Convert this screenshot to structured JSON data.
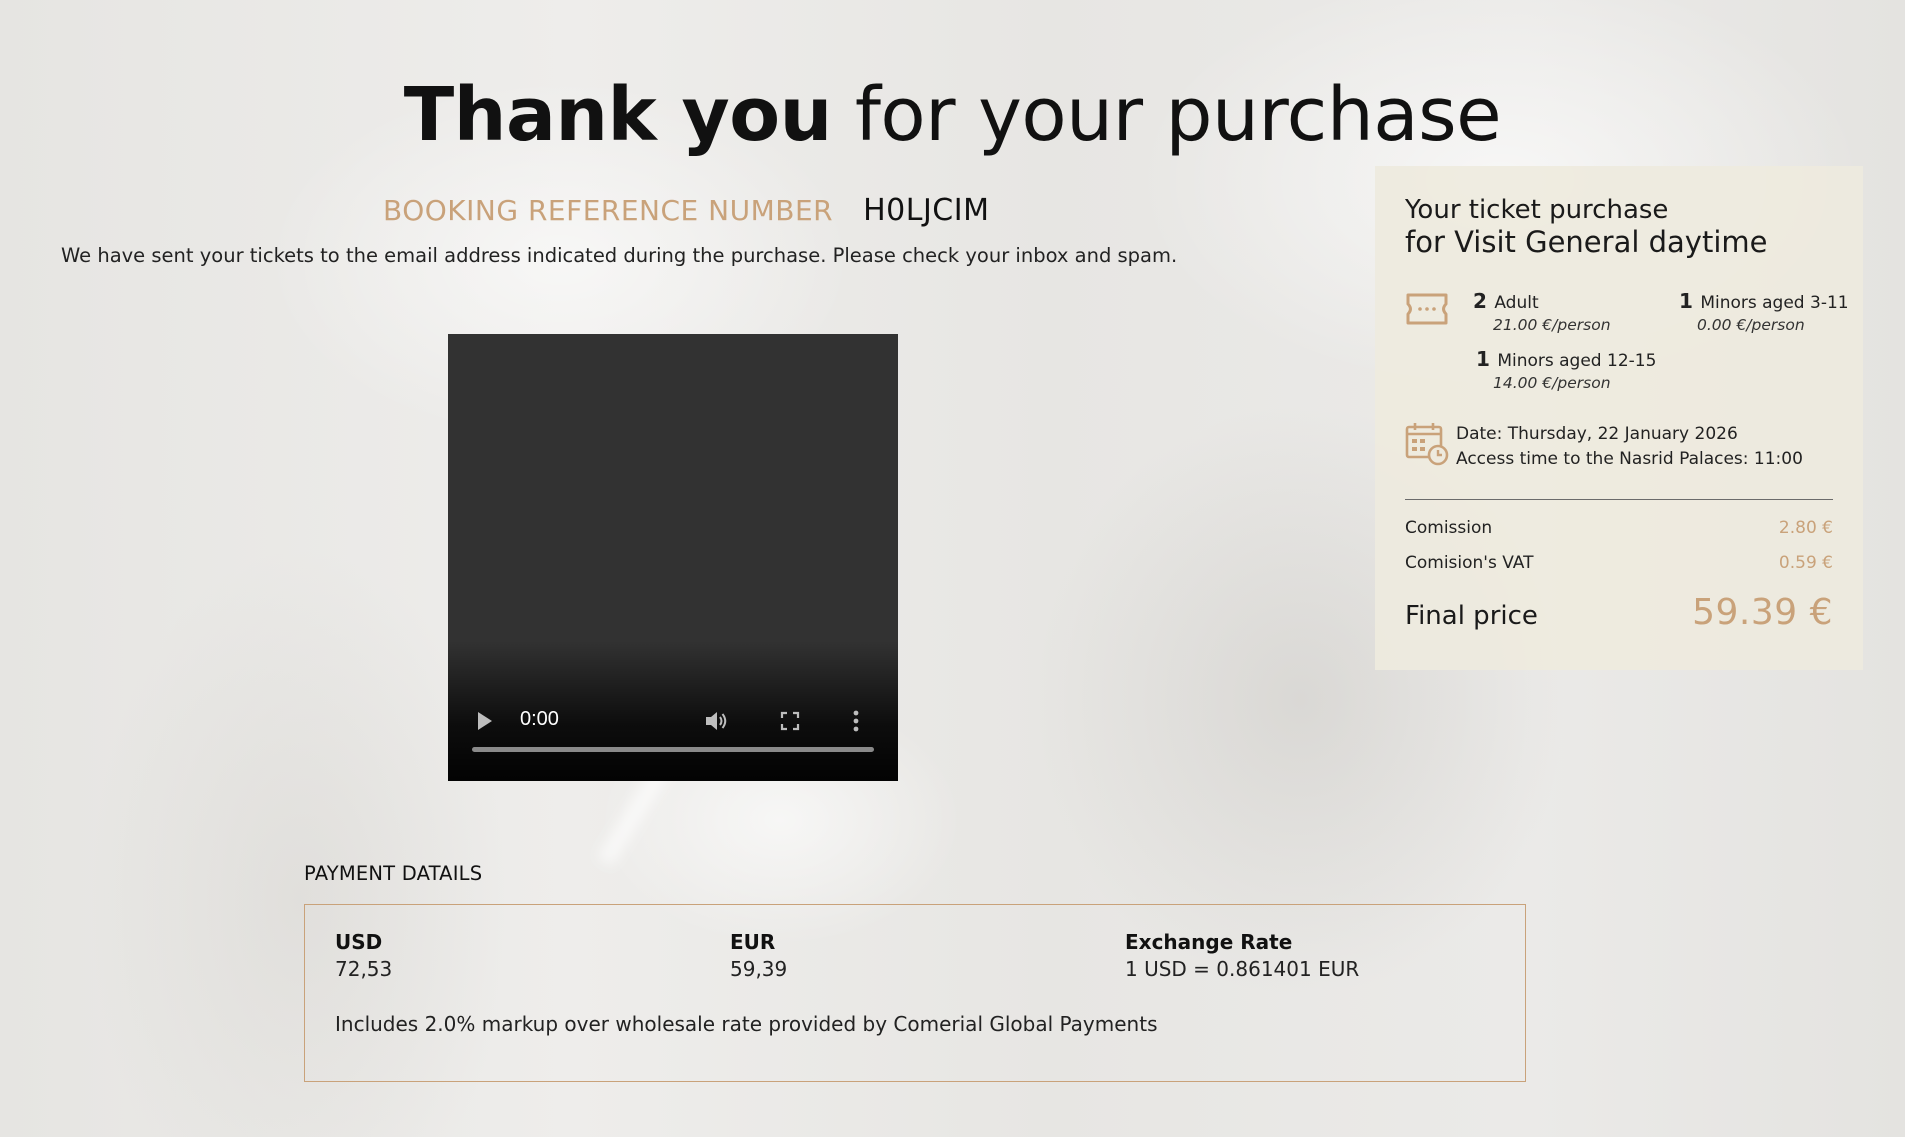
{
  "header": {
    "title_strong": "Thank you",
    "title_rest": "for your purchase"
  },
  "booking": {
    "label": "BOOKING REFERENCE NUMBER",
    "code": "H0LJCIM",
    "sent_message": "We have sent your tickets to the email address indicated during the purchase. Please check your inbox and spam."
  },
  "video": {
    "current_time": "0:00",
    "progress": 0
  },
  "payment": {
    "title": "PAYMENT DATAILS",
    "columns": [
      {
        "head": "USD",
        "value": "72,53"
      },
      {
        "head": "EUR",
        "value": "59,39"
      },
      {
        "head": "Exchange Rate",
        "value": "1 USD = 0.861401 EUR"
      }
    ],
    "note": "Includes 2.0% markup over wholesale rate provided by Comerial Global Payments"
  },
  "summary": {
    "title_line1": "Your ticket purchase",
    "title_line2": "for Visit General daytime",
    "tickets": [
      {
        "qty": "2",
        "label": "Adult",
        "price": "21.00 €/person"
      },
      {
        "qty": "1",
        "label": "Minors aged 3-11",
        "price": "0.00 €/person"
      },
      {
        "qty": "1",
        "label": "Minors aged 12-15",
        "price": "14.00 €/person"
      }
    ],
    "date_text": "Date: Thursday, 22 January 2026",
    "access_text": "Access time to the Nasrid Palaces: 11:00",
    "fees": [
      {
        "label": "Comission",
        "amount": "2.80 €"
      },
      {
        "label": "Comision's VAT",
        "amount": "0.59 €"
      }
    ],
    "final_label": "Final price",
    "final_amount": "59.39 €"
  },
  "colors": {
    "accent": "#c9a27a",
    "text": "#1a1a1a",
    "card_bg": "#eeeade",
    "video_bg": "#323232"
  },
  "icons": [
    "ticket-icon",
    "calendar-clock-icon",
    "play-icon",
    "volume-icon",
    "fullscreen-icon",
    "more-options-icon"
  ]
}
